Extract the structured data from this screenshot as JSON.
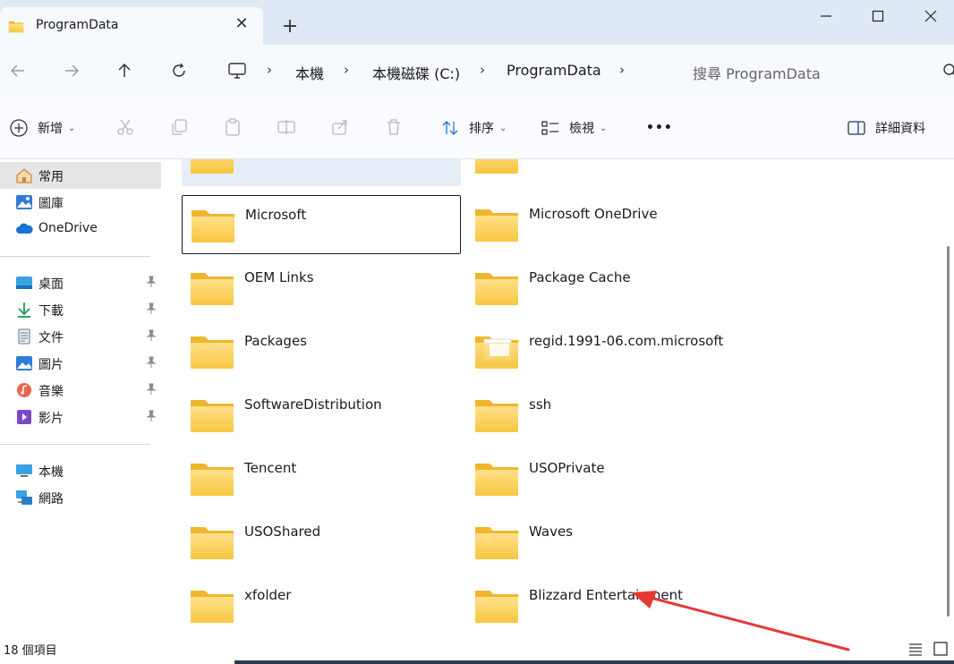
{
  "window": {
    "tab_title": "ProgramData",
    "tab_close_icon": "close-icon",
    "new_tab_icon": "plus-icon"
  },
  "nav": {
    "breadcrumbs": [
      "本機",
      "本機磁碟 (C:)",
      "ProgramData"
    ],
    "search_placeholder": "搜尋 ProgramData"
  },
  "toolbar": {
    "new_label": "新增",
    "sort_label": "排序",
    "view_label": "檢視",
    "more_label": "•••",
    "details_label": "詳細資料"
  },
  "sidebar": {
    "top": [
      {
        "label": "常用",
        "icon": "home-icon"
      },
      {
        "label": "圖庫",
        "icon": "gallery-icon"
      },
      {
        "label": "OneDrive",
        "icon": "cloud-icon"
      }
    ],
    "pinned": [
      {
        "label": "桌面",
        "icon": "desktop-icon"
      },
      {
        "label": "下載",
        "icon": "download-icon"
      },
      {
        "label": "文件",
        "icon": "document-icon"
      },
      {
        "label": "圖片",
        "icon": "pictures-icon"
      },
      {
        "label": "音樂",
        "icon": "music-icon"
      },
      {
        "label": "影片",
        "icon": "video-icon"
      }
    ],
    "bottom": [
      {
        "label": "本機",
        "icon": "computer-icon"
      },
      {
        "label": "網路",
        "icon": "network-icon"
      }
    ]
  },
  "folders": [
    {
      "name": "Microsoft"
    },
    {
      "name": "Microsoft OneDrive"
    },
    {
      "name": "OEM Links"
    },
    {
      "name": "Package Cache"
    },
    {
      "name": "Packages"
    },
    {
      "name": "regid.1991-06.com.microsoft"
    },
    {
      "name": "SoftwareDistribution"
    },
    {
      "name": "ssh"
    },
    {
      "name": "Tencent"
    },
    {
      "name": "USOPrivate"
    },
    {
      "name": "USOShared"
    },
    {
      "name": "Waves"
    },
    {
      "name": "xfolder"
    },
    {
      "name": "Blizzard Entertainment"
    }
  ],
  "status": {
    "item_count": "18 個項目"
  },
  "colors": {
    "folder_body": "#f8cf55",
    "folder_back": "#f1b82d",
    "annotation": "#e53935"
  }
}
